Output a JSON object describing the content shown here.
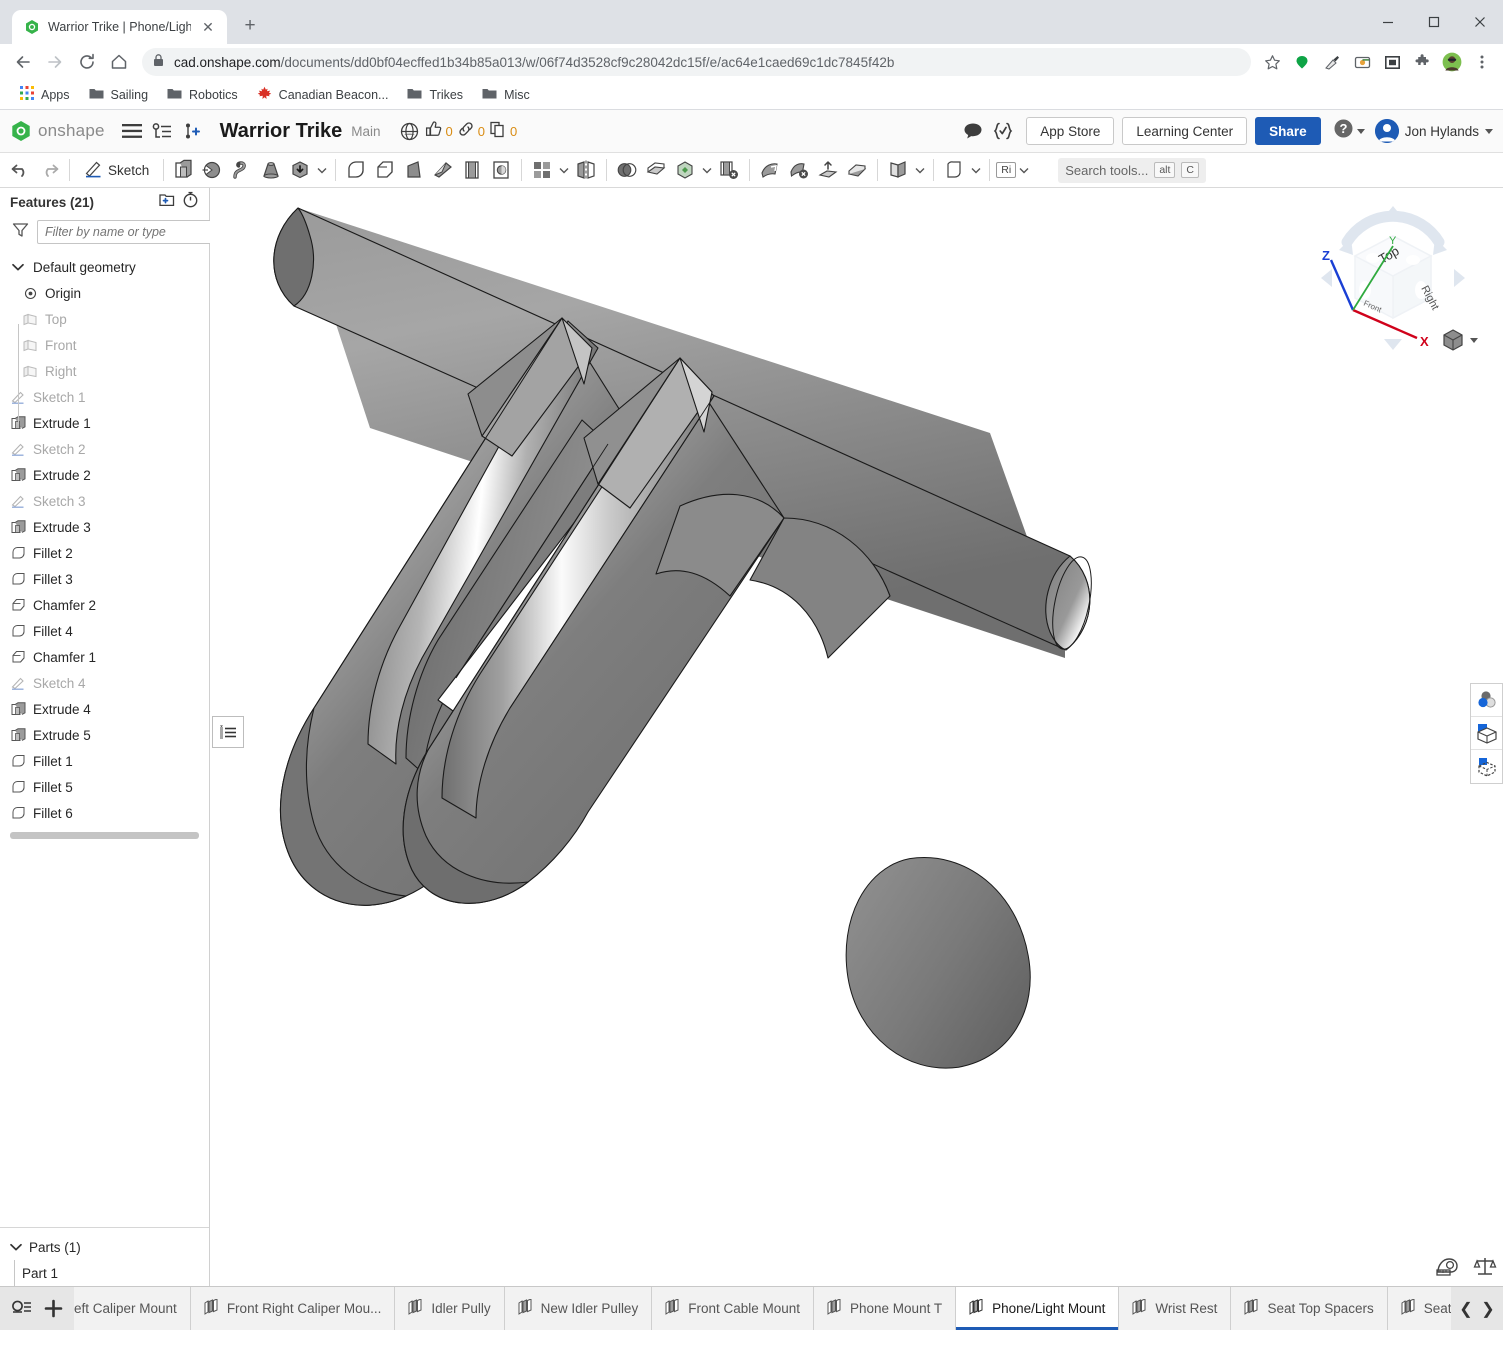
{
  "browser": {
    "tab": {
      "title": "Warrior Trike | Phone/Light Mo",
      "favicon_name": "onshape-favicon"
    },
    "newtab_label": "+",
    "window": {
      "minimize": "–",
      "maximize": "□",
      "close": "✕"
    },
    "url": {
      "host": "cad.onshape.com",
      "path": "/documents/dd0bf04ecffed1b34b85a013/w/06f74d3528cf9c28042dc15f/e/ac64e1caed69c1dc7845f42b"
    },
    "bookmarks": [
      {
        "label": "Apps",
        "icon": "apps-grid-icon"
      },
      {
        "label": "Sailing",
        "icon": "folder-icon"
      },
      {
        "label": "Robotics",
        "icon": "folder-icon"
      },
      {
        "label": "Canadian Beacon...",
        "icon": "maple-leaf-icon"
      },
      {
        "label": "Trikes",
        "icon": "folder-icon"
      },
      {
        "label": "Misc",
        "icon": "folder-icon"
      }
    ]
  },
  "onshape": {
    "brand": "onshape",
    "document_title": "Warrior Trike",
    "branch": "Main",
    "counts": {
      "likes": "0",
      "links": "0",
      "copies": "0"
    },
    "buttons": {
      "app_store": "App Store",
      "learning_center": "Learning Center",
      "share": "Share"
    },
    "user": "Jon Hylands",
    "toolbar": {
      "sketch_label": "Sketch",
      "search_placeholder": "Search tools...",
      "search_key_alt": "alt",
      "search_key_c": "C",
      "ri_label": "Ri"
    }
  },
  "feature_tree": {
    "header": "Features (21)",
    "filter_placeholder": "Filter by name or type",
    "default_geometry_label": "Default geometry",
    "default_geometry_children": [
      {
        "label": "Origin",
        "icon": "origin-icon",
        "muted": false
      },
      {
        "label": "Top",
        "icon": "plane-icon",
        "muted": true
      },
      {
        "label": "Front",
        "icon": "plane-icon",
        "muted": true
      },
      {
        "label": "Right",
        "icon": "plane-icon",
        "muted": true
      }
    ],
    "features": [
      {
        "label": "Sketch 1",
        "icon": "sketch-icon",
        "muted": true
      },
      {
        "label": "Extrude 1",
        "icon": "extrude-icon",
        "muted": false
      },
      {
        "label": "Sketch 2",
        "icon": "sketch-icon",
        "muted": true
      },
      {
        "label": "Extrude 2",
        "icon": "extrude-icon",
        "muted": false
      },
      {
        "label": "Sketch 3",
        "icon": "sketch-icon",
        "muted": true
      },
      {
        "label": "Extrude 3",
        "icon": "extrude-icon",
        "muted": false
      },
      {
        "label": "Fillet 2",
        "icon": "fillet-icon",
        "muted": false
      },
      {
        "label": "Fillet 3",
        "icon": "fillet-icon",
        "muted": false
      },
      {
        "label": "Chamfer 2",
        "icon": "chamfer-icon",
        "muted": false
      },
      {
        "label": "Fillet 4",
        "icon": "fillet-icon",
        "muted": false
      },
      {
        "label": "Chamfer 1",
        "icon": "chamfer-icon",
        "muted": false
      },
      {
        "label": "Sketch 4",
        "icon": "sketch-icon",
        "muted": true
      },
      {
        "label": "Extrude 4",
        "icon": "extrude-icon",
        "muted": false
      },
      {
        "label": "Extrude 5",
        "icon": "extrude-icon",
        "muted": false
      },
      {
        "label": "Fillet 1",
        "icon": "fillet-icon",
        "muted": false
      },
      {
        "label": "Fillet 5",
        "icon": "fillet-icon",
        "muted": false
      },
      {
        "label": "Fillet 6",
        "icon": "fillet-icon",
        "muted": false
      }
    ],
    "parts_header": "Parts (1)",
    "parts": [
      {
        "label": "Part 1"
      }
    ]
  },
  "viewcube": {
    "face_top": "Top",
    "face_front": "Front",
    "face_right": "Right",
    "axis_x": "X",
    "axis_y": "Y",
    "axis_z": "Z",
    "colors": {
      "x": "#d0021b",
      "y": "#2faa3e",
      "z": "#1a3fd4"
    }
  },
  "tabbar": {
    "tabs": [
      {
        "label": "eft Caliper Mount",
        "active": false,
        "clipped": true
      },
      {
        "label": "Front Right Caliper Mou...",
        "active": false
      },
      {
        "label": "Idler Pully",
        "active": false
      },
      {
        "label": "New Idler Pulley",
        "active": false
      },
      {
        "label": "Front Cable Mount",
        "active": false
      },
      {
        "label": "Phone Mount T",
        "active": false
      },
      {
        "label": "Phone/Light Mount",
        "active": true
      },
      {
        "label": "Wrist Rest",
        "active": false
      },
      {
        "label": "Seat Top Spacers",
        "active": false
      },
      {
        "label": "Seat Bo",
        "active": false,
        "clipped": true
      }
    ],
    "prev_arrow": "❮",
    "next_arrow": "❯",
    "add_label": "+"
  },
  "colors": {
    "accent": "#1e5bb5",
    "chrome_bg": "#dee1e6",
    "panel_bg": "#fafafa",
    "model_grey": "#8f8f8f",
    "count_orange": "#d98c13"
  }
}
